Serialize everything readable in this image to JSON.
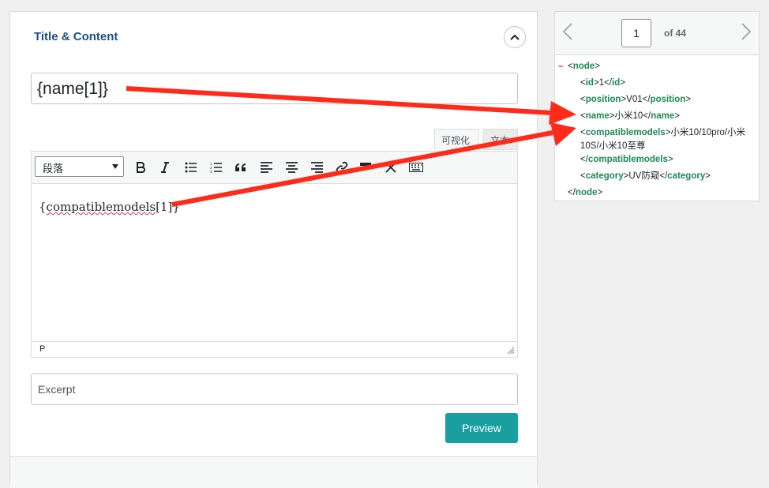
{
  "panel": {
    "title": "Title & Content",
    "name_field_value": "{name[1]}",
    "tab_visual": "可视化",
    "tab_text": "文本",
    "format_select": "段落",
    "editor_content": "{compatiblemodels[1]}",
    "editor_content_open": "{",
    "editor_content_word": "compatiblemodels",
    "editor_content_close": "[1]}",
    "status_path": "P",
    "excerpt_placeholder": "Excerpt",
    "preview_label": "Preview"
  },
  "toolbar_icons": [
    "bold-icon",
    "italic-icon",
    "bulleted-list-icon",
    "numbered-list-icon",
    "blockquote-icon",
    "align-left-icon",
    "align-center-icon",
    "align-right-icon",
    "link-icon",
    "read-more-icon",
    "fullscreen-icon",
    "toolbar-toggle-icon"
  ],
  "pager": {
    "current_page": "1",
    "of_label": "of 44"
  },
  "xml": {
    "root_open_bracket": "<",
    "root_tag": "node",
    "root_close_bracket": ">",
    "fields": [
      {
        "tag": "id",
        "value": "1"
      },
      {
        "tag": "position",
        "value": "V01"
      },
      {
        "tag": "name",
        "value": "小米10"
      },
      {
        "tag": "compatiblemodels",
        "value": "小米10/10pro/小米10S/小米10至尊"
      },
      {
        "tag": "category",
        "value": "UV防窥"
      }
    ],
    "root_end_tag": "node"
  },
  "colors": {
    "accent": "#1a9fa1",
    "title": "#1d4f8a",
    "xml_tag": "#1a8b52",
    "arrow": "#ff2a1a"
  }
}
